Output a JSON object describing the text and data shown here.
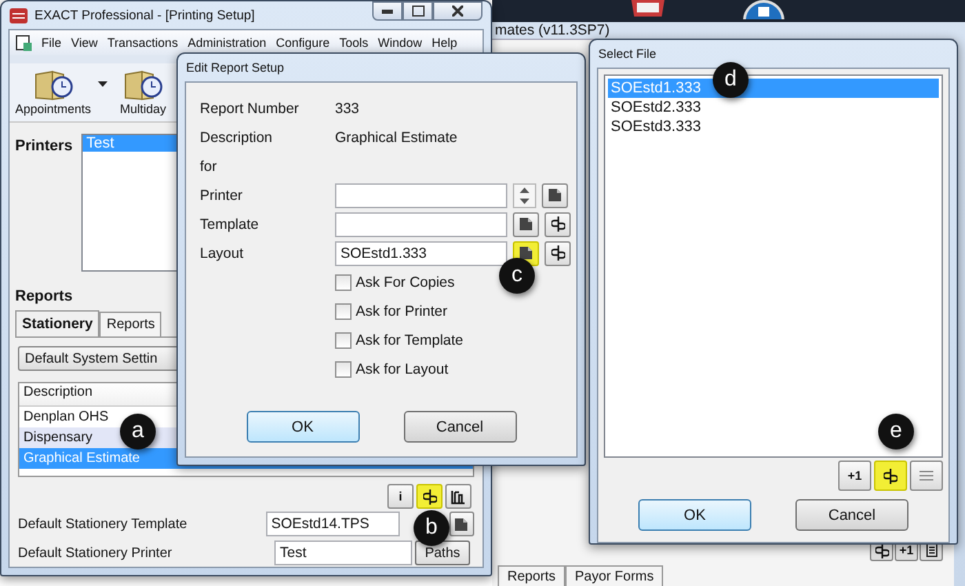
{
  "back_window": {
    "title": "mates (v11.3SP7)",
    "tabs": [
      {
        "label": "Reports",
        "selected": false
      },
      {
        "label": "Payor Forms",
        "selected": false
      }
    ],
    "tools": [
      {
        "kind": "split"
      },
      {
        "kind": "plus",
        "label": "+1"
      },
      {
        "kind": "page"
      }
    ]
  },
  "main_window": {
    "title": "EXACT Professional - [Printing Setup]",
    "menu": [
      "File",
      "View",
      "Transactions",
      "Administration",
      "Configure",
      "Tools",
      "Window",
      "Help"
    ],
    "toolbar": [
      {
        "label": "Appointments",
        "dropdown": true
      },
      {
        "label": "Multiday",
        "dropdown": false
      }
    ],
    "printers": {
      "label": "Printers",
      "items": [
        {
          "label": "Test",
          "selected": true
        }
      ]
    },
    "reports": {
      "label": "Reports",
      "tabs": [
        {
          "label": "Stationery",
          "selected": true
        },
        {
          "label": "Reports",
          "selected": false
        }
      ],
      "dropdown": "Default System Settin",
      "columns": [
        "Description"
      ],
      "rows": [
        {
          "label": "Denplan OHS",
          "selected": false,
          "shaded": false
        },
        {
          "label": "Dispensary",
          "selected": false,
          "shaded": true
        },
        {
          "label": "Graphical Estimate",
          "selected": true,
          "shaded": false
        }
      ]
    },
    "tools": [
      {
        "kind": "info",
        "label": "i",
        "highlighted": false
      },
      {
        "kind": "split",
        "highlighted": true
      },
      {
        "kind": "columns",
        "highlighted": false
      }
    ],
    "fields": [
      {
        "label": "Default Stationery Template",
        "value": "SOEstd14.TPS",
        "kind": "browse"
      },
      {
        "label": "Default Stationery Printer",
        "value": "Test",
        "kind": "paths",
        "button": "Paths"
      }
    ]
  },
  "edit_dialog": {
    "title": "Edit Report Setup",
    "info": [
      {
        "label": "Report Number",
        "value": "333"
      },
      {
        "label": "Description",
        "value": "Graphical Estimate"
      },
      {
        "label": "for"
      }
    ],
    "fields": [
      {
        "label": "Printer",
        "buttons": [
          {
            "kind": "spin",
            "highlighted": false
          },
          {
            "kind": "browse",
            "highlighted": false
          }
        ]
      },
      {
        "label": "Template",
        "buttons": [
          {
            "kind": "browse",
            "highlighted": false
          },
          {
            "kind": "split",
            "highlighted": false
          }
        ]
      },
      {
        "label": "Layout",
        "value": "SOEstd1.333",
        "buttons": [
          {
            "kind": "browse",
            "highlighted": true
          },
          {
            "kind": "split",
            "highlighted": false
          }
        ]
      }
    ],
    "checkboxes": [
      {
        "label": "Ask For Copies",
        "checked": false
      },
      {
        "label": "Ask for Printer",
        "checked": false
      },
      {
        "label": "Ask for Template",
        "checked": false
      },
      {
        "label": "Ask for Layout",
        "checked": false
      }
    ],
    "buttons": [
      {
        "label": "OK",
        "default": true
      },
      {
        "label": "Cancel",
        "default": false
      }
    ]
  },
  "select_file": {
    "title": "Select File",
    "files": [
      {
        "label": "SOEstd1.333",
        "selected": true
      },
      {
        "label": "SOEstd2.333",
        "selected": false
      },
      {
        "label": "SOEstd3.333",
        "selected": false
      }
    ],
    "tools": [
      {
        "kind": "plus",
        "label": "+1",
        "highlighted": false
      },
      {
        "kind": "split",
        "highlighted": true
      },
      {
        "kind": "list",
        "highlighted": false
      }
    ],
    "buttons": [
      {
        "label": "OK",
        "default": true
      },
      {
        "label": "Cancel",
        "default": false
      }
    ]
  },
  "callouts": [
    "a",
    "b",
    "c",
    "d",
    "e"
  ]
}
